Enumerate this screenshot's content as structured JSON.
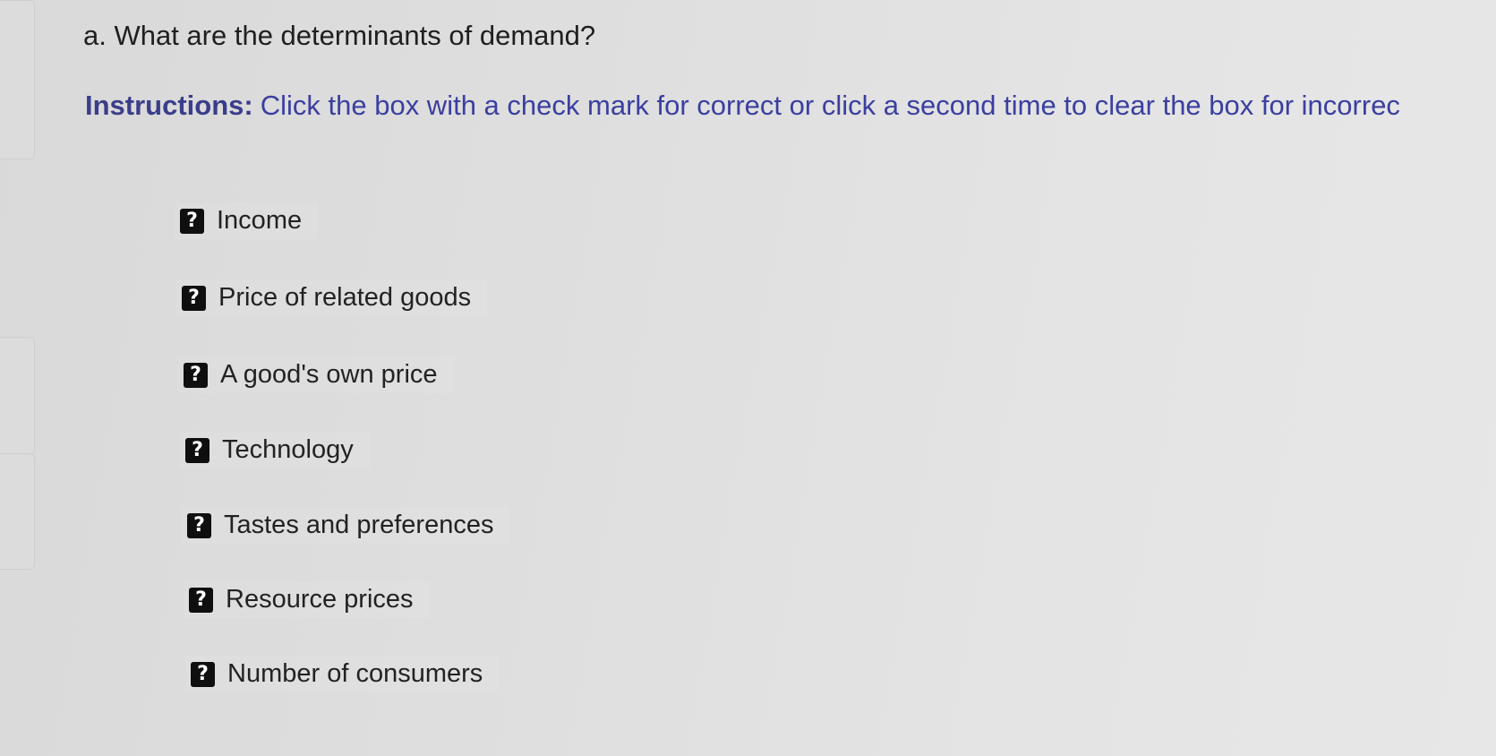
{
  "question": {
    "text": "a. What are the determinants of demand?"
  },
  "instructions": {
    "label": "Instructions:",
    "text": "Click the box with a check mark for correct or click a second time to clear the box for incorrec"
  },
  "options": [
    {
      "label": "Income",
      "state": "?"
    },
    {
      "label": "Price of related goods",
      "state": "?"
    },
    {
      "label": "A good's own price",
      "state": "?"
    },
    {
      "label": "Technology",
      "state": "?"
    },
    {
      "label": "Tastes and preferences",
      "state": "?"
    },
    {
      "label": "Resource prices",
      "state": "?"
    },
    {
      "label": "Number of consumers",
      "state": "?"
    }
  ],
  "colors": {
    "instructions_text": "#3b3fa0",
    "checkbox_bg": "#0f0f0f"
  }
}
